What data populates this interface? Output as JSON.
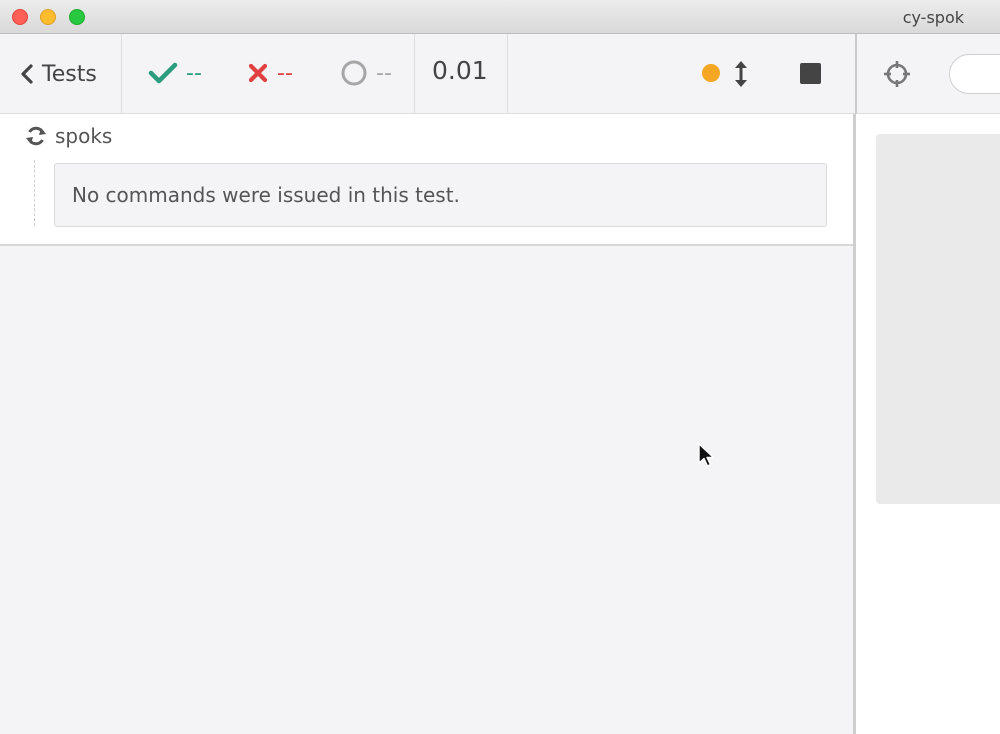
{
  "window": {
    "title": "cy-spok"
  },
  "header": {
    "back_label": "Tests",
    "passed": "--",
    "failed": "--",
    "pending": "--",
    "duration": "0.01"
  },
  "runnable": {
    "title": "spoks",
    "message": "No commands were issued in this test."
  },
  "colors": {
    "passed": "#2c9c7f",
    "failed": "#e04040",
    "running": "#f5a623"
  },
  "icons": [
    "chevron-left-icon",
    "check-icon",
    "x-icon",
    "circle-pending-icon",
    "autoscroll-icon",
    "stop-icon",
    "refresh-icon",
    "crosshair-icon",
    "mouse-cursor-icon"
  ]
}
